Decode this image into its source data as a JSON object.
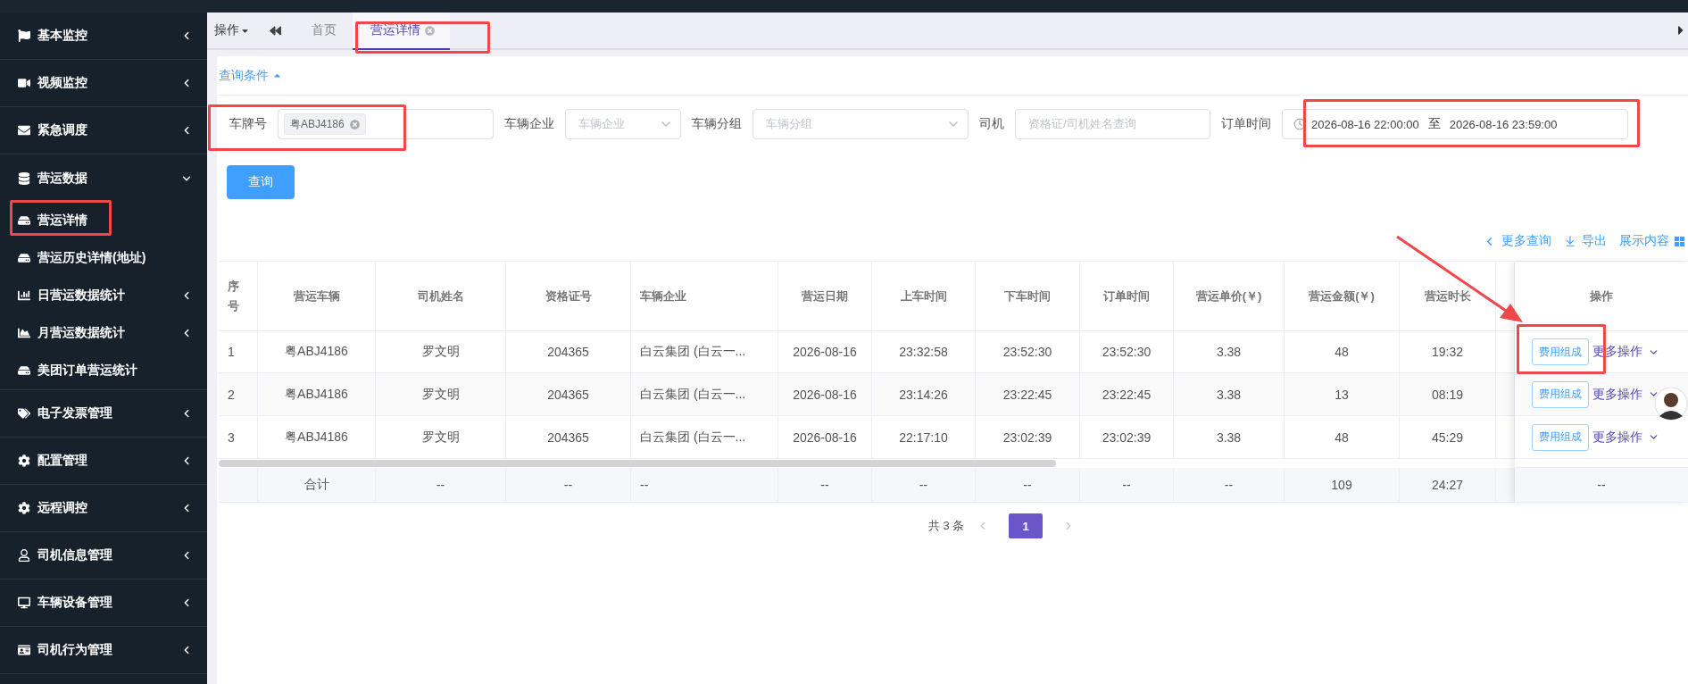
{
  "sidebar": {
    "items": [
      {
        "label": "基本监控",
        "expanded": false
      },
      {
        "label": "视频监控",
        "expanded": false
      },
      {
        "label": "紧急调度",
        "expanded": false
      },
      {
        "label": "营运数据",
        "expanded": true,
        "children": [
          {
            "label": "营运详情",
            "kind": "link"
          },
          {
            "label": "营运历史详情(地址)",
            "kind": "link"
          },
          {
            "label": "日营运数据统计",
            "kind": "group",
            "expanded": false
          },
          {
            "label": "月营运数据统计",
            "kind": "group",
            "expanded": false
          },
          {
            "label": "美团订单营运统计",
            "kind": "link"
          }
        ]
      },
      {
        "label": "电子发票管理",
        "expanded": false
      },
      {
        "label": "配置管理",
        "expanded": false
      },
      {
        "label": "远程调控",
        "expanded": false
      },
      {
        "label": "司机信息管理",
        "expanded": false
      },
      {
        "label": "车辆设备管理",
        "expanded": false
      },
      {
        "label": "司机行为管理",
        "expanded": false
      }
    ]
  },
  "tab_bar": {
    "menu": "操作",
    "tabs": [
      {
        "label": "首页",
        "selected": false,
        "closable": false
      },
      {
        "label": "营运详情",
        "selected": true,
        "closable": true
      }
    ]
  },
  "query": {
    "toggle": {
      "label": "查询条件",
      "expanded": true
    },
    "filters": [
      {
        "kind": "tags",
        "label": "车牌号",
        "tags": [
          "粤ABJ4186"
        ]
      },
      {
        "kind": "select",
        "label": "车辆企业",
        "placeholder": "车辆企业"
      },
      {
        "kind": "select",
        "label": "车辆分组",
        "placeholder": "车辆分组"
      },
      {
        "kind": "input",
        "label": "司机",
        "placeholder": "资格证/司机姓名查询"
      },
      {
        "kind": "daterange",
        "label": "订单时间",
        "start": "2026-08-16 22:00:00",
        "separator": "至",
        "end": "2026-08-16 23:59:00"
      }
    ],
    "search_button": "查询"
  },
  "toolbar": [
    "更多查询",
    "导出",
    "展示内容"
  ],
  "table": {
    "columns": [
      "序号",
      "营运车辆",
      "司机姓名",
      "资格证号",
      "车辆企业",
      "营运日期",
      "上车时间",
      "下车时间",
      "订单时间",
      "营运单价(￥)",
      "营运金额(￥)",
      "营运时长"
    ],
    "action_column": "操作",
    "rows": [
      {
        "cells": [
          "1",
          "粤ABJ4186",
          "罗文明",
          "204365",
          "白云集团 (白云一...",
          "2026-08-16",
          "23:32:58",
          "23:52:30",
          "23:52:30",
          "3.38",
          "48",
          "19:32"
        ],
        "actions": [
          "费用组成",
          "更多操作"
        ]
      },
      {
        "cells": [
          "2",
          "粤ABJ4186",
          "罗文明",
          "204365",
          "白云集团 (白云一...",
          "2026-08-16",
          "23:14:26",
          "23:22:45",
          "23:22:45",
          "3.38",
          "13",
          "08:19"
        ],
        "actions": [
          "费用组成",
          "更多操作"
        ]
      },
      {
        "cells": [
          "3",
          "粤ABJ4186",
          "罗文明",
          "204365",
          "白云集团 (白云一...",
          "2026-08-16",
          "22:17:10",
          "23:02:39",
          "23:02:39",
          "3.38",
          "48",
          "45:29"
        ],
        "actions": [
          "费用组成",
          "更多操作"
        ]
      }
    ],
    "total": {
      "cells": [
        "",
        "合计",
        "--",
        "--",
        "--",
        "--",
        "--",
        "--",
        "--",
        "--",
        "109",
        "24:27"
      ],
      "action": "--"
    }
  },
  "pagination": {
    "total": "共 3 条",
    "pages": [
      {
        "label": "1",
        "selected": true
      }
    ]
  }
}
